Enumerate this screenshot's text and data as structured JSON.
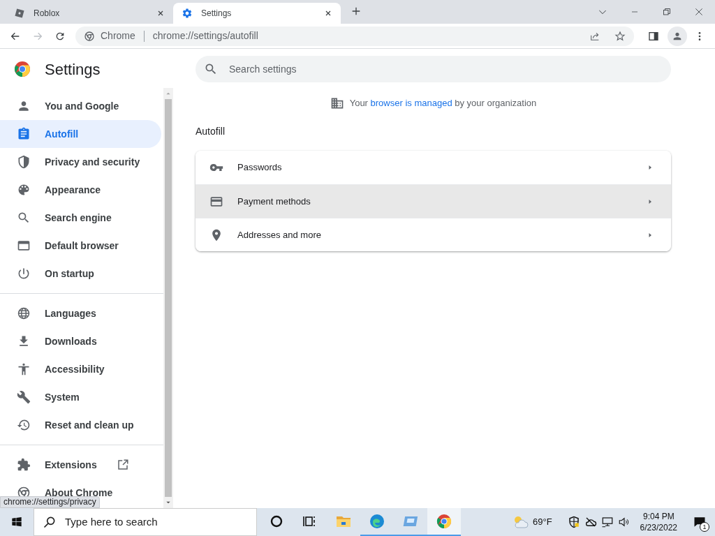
{
  "tabs": [
    {
      "title": "Roblox",
      "selected": false,
      "kind": "roblox"
    },
    {
      "title": "Settings",
      "selected": true,
      "kind": "settings"
    }
  ],
  "toolbar": {
    "site_label": "Chrome",
    "url": "chrome://settings/autofill"
  },
  "settings_title": "Settings",
  "search": {
    "placeholder": "Search settings"
  },
  "sidebar": {
    "groups": [
      {
        "items": [
          {
            "label": "You and Google",
            "selected": false,
            "kind": "page"
          },
          {
            "label": "Autofill",
            "selected": true,
            "kind": "page"
          },
          {
            "label": "Privacy and security",
            "selected": false,
            "kind": "page"
          },
          {
            "label": "Appearance",
            "selected": false,
            "kind": "page"
          },
          {
            "label": "Search engine",
            "selected": false,
            "kind": "page"
          },
          {
            "label": "Default browser",
            "selected": false,
            "kind": "page"
          },
          {
            "label": "On startup",
            "selected": false,
            "kind": "page"
          }
        ]
      },
      {
        "items": [
          {
            "label": "Languages",
            "selected": false,
            "kind": "page"
          },
          {
            "label": "Downloads",
            "selected": false,
            "kind": "page"
          },
          {
            "label": "Accessibility",
            "selected": false,
            "kind": "page"
          },
          {
            "label": "System",
            "selected": false,
            "kind": "page"
          },
          {
            "label": "Reset and clean up",
            "selected": false,
            "kind": "page"
          }
        ]
      },
      {
        "items": [
          {
            "label": "Extensions",
            "selected": false,
            "kind": "external"
          },
          {
            "label": "About Chrome",
            "selected": false,
            "kind": "page"
          }
        ]
      }
    ]
  },
  "managed_notice": {
    "before": "Your",
    "link": "browser is managed",
    "after": "by your organization"
  },
  "section_title": "Autofill",
  "rows": [
    {
      "label": "Passwords",
      "hovered": false
    },
    {
      "label": "Payment methods",
      "hovered": true
    },
    {
      "label": "Addresses and more",
      "hovered": false
    }
  ],
  "status_bubble": "chrome://settings/privacy",
  "taskbar": {
    "search_placeholder": "Type here to search",
    "apps": [
      {
        "kind": "cortana",
        "open": false,
        "selected": false
      },
      {
        "kind": "taskview",
        "open": false,
        "selected": false
      },
      {
        "kind": "explorer",
        "open": false,
        "selected": false
      },
      {
        "kind": "edge",
        "open": true,
        "selected": false
      },
      {
        "kind": "app",
        "open": true,
        "selected": false
      },
      {
        "kind": "chrome",
        "open": true,
        "selected": true
      }
    ],
    "temperature": "69°F",
    "time": "9:04 PM",
    "date": "6/23/2022",
    "notifications": "1"
  }
}
